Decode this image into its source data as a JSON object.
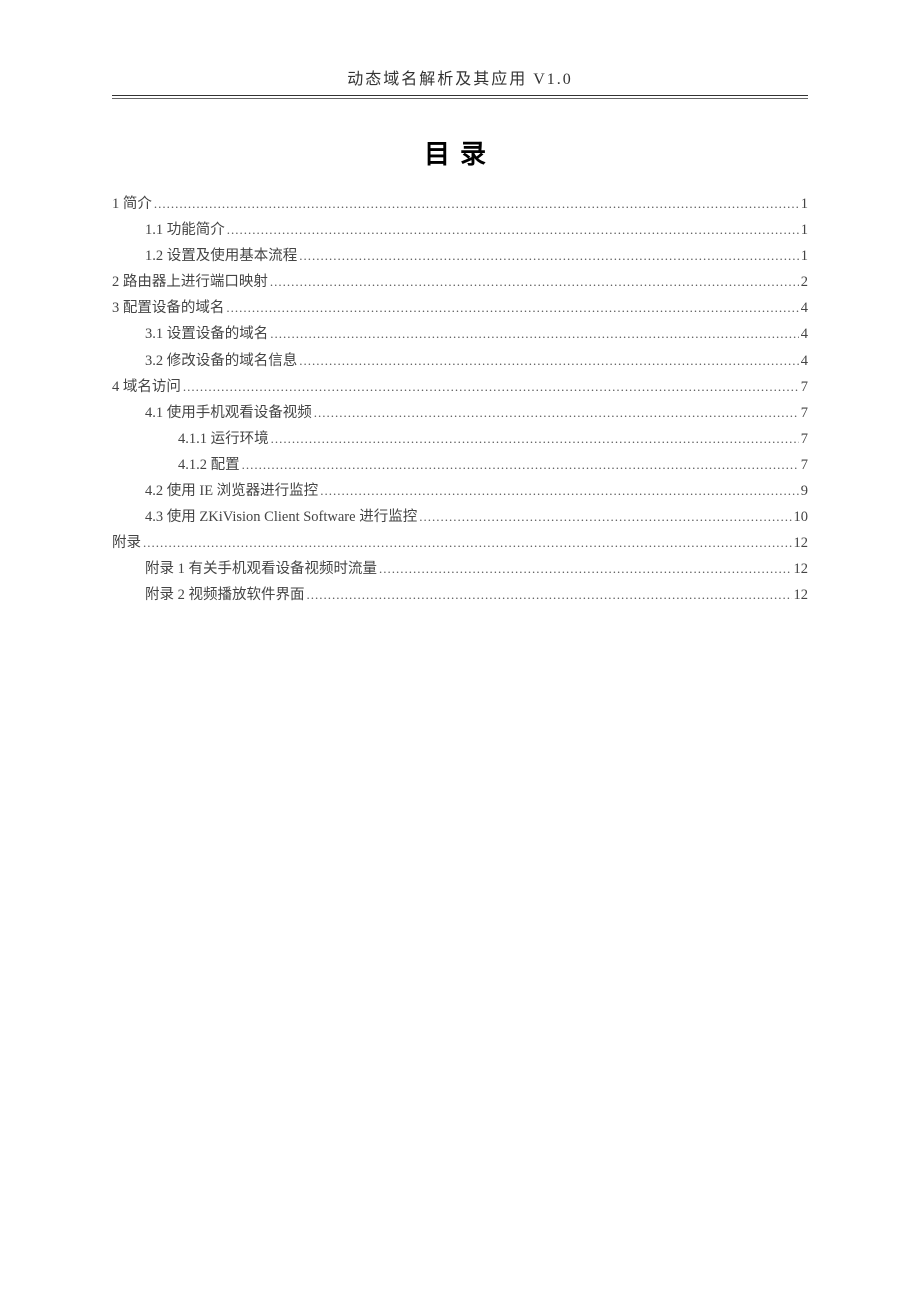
{
  "header": {
    "title": "动态域名解析及其应用 V1.0"
  },
  "toc": {
    "heading": "目录",
    "entries": [
      {
        "level": 0,
        "label": "1 简介",
        "page": "1"
      },
      {
        "level": 1,
        "label": "1.1 功能简介",
        "page": "1"
      },
      {
        "level": 1,
        "label": "1.2 设置及使用基本流程",
        "page": "1"
      },
      {
        "level": 0,
        "label": "2 路由器上进行端口映射",
        "page": "2"
      },
      {
        "level": 0,
        "label": "3 配置设备的域名",
        "page": "4"
      },
      {
        "level": 1,
        "label": "3.1 设置设备的域名",
        "page": "4"
      },
      {
        "level": 1,
        "label": "3.2 修改设备的域名信息",
        "page": "4"
      },
      {
        "level": 0,
        "label": "4 域名访问",
        "page": "7"
      },
      {
        "level": 1,
        "label": "4.1 使用手机观看设备视频",
        "page": "7"
      },
      {
        "level": 2,
        "label": "4.1.1 运行环境",
        "page": "7"
      },
      {
        "level": 2,
        "label": "4.1.2 配置",
        "page": "7"
      },
      {
        "level": 1,
        "label": "4.2 使用 IE 浏览器进行监控",
        "page": "9"
      },
      {
        "level": 1,
        "label": "4.3 使用 ZKiVision Client Software 进行监控",
        "page": "10"
      },
      {
        "level": 0,
        "label": "附录",
        "page": "12"
      },
      {
        "level": 1,
        "label": "附录 1 有关手机观看设备视频时流量",
        "page": "12"
      },
      {
        "level": 1,
        "label": "附录 2 视频播放软件界面",
        "page": "12"
      }
    ]
  }
}
